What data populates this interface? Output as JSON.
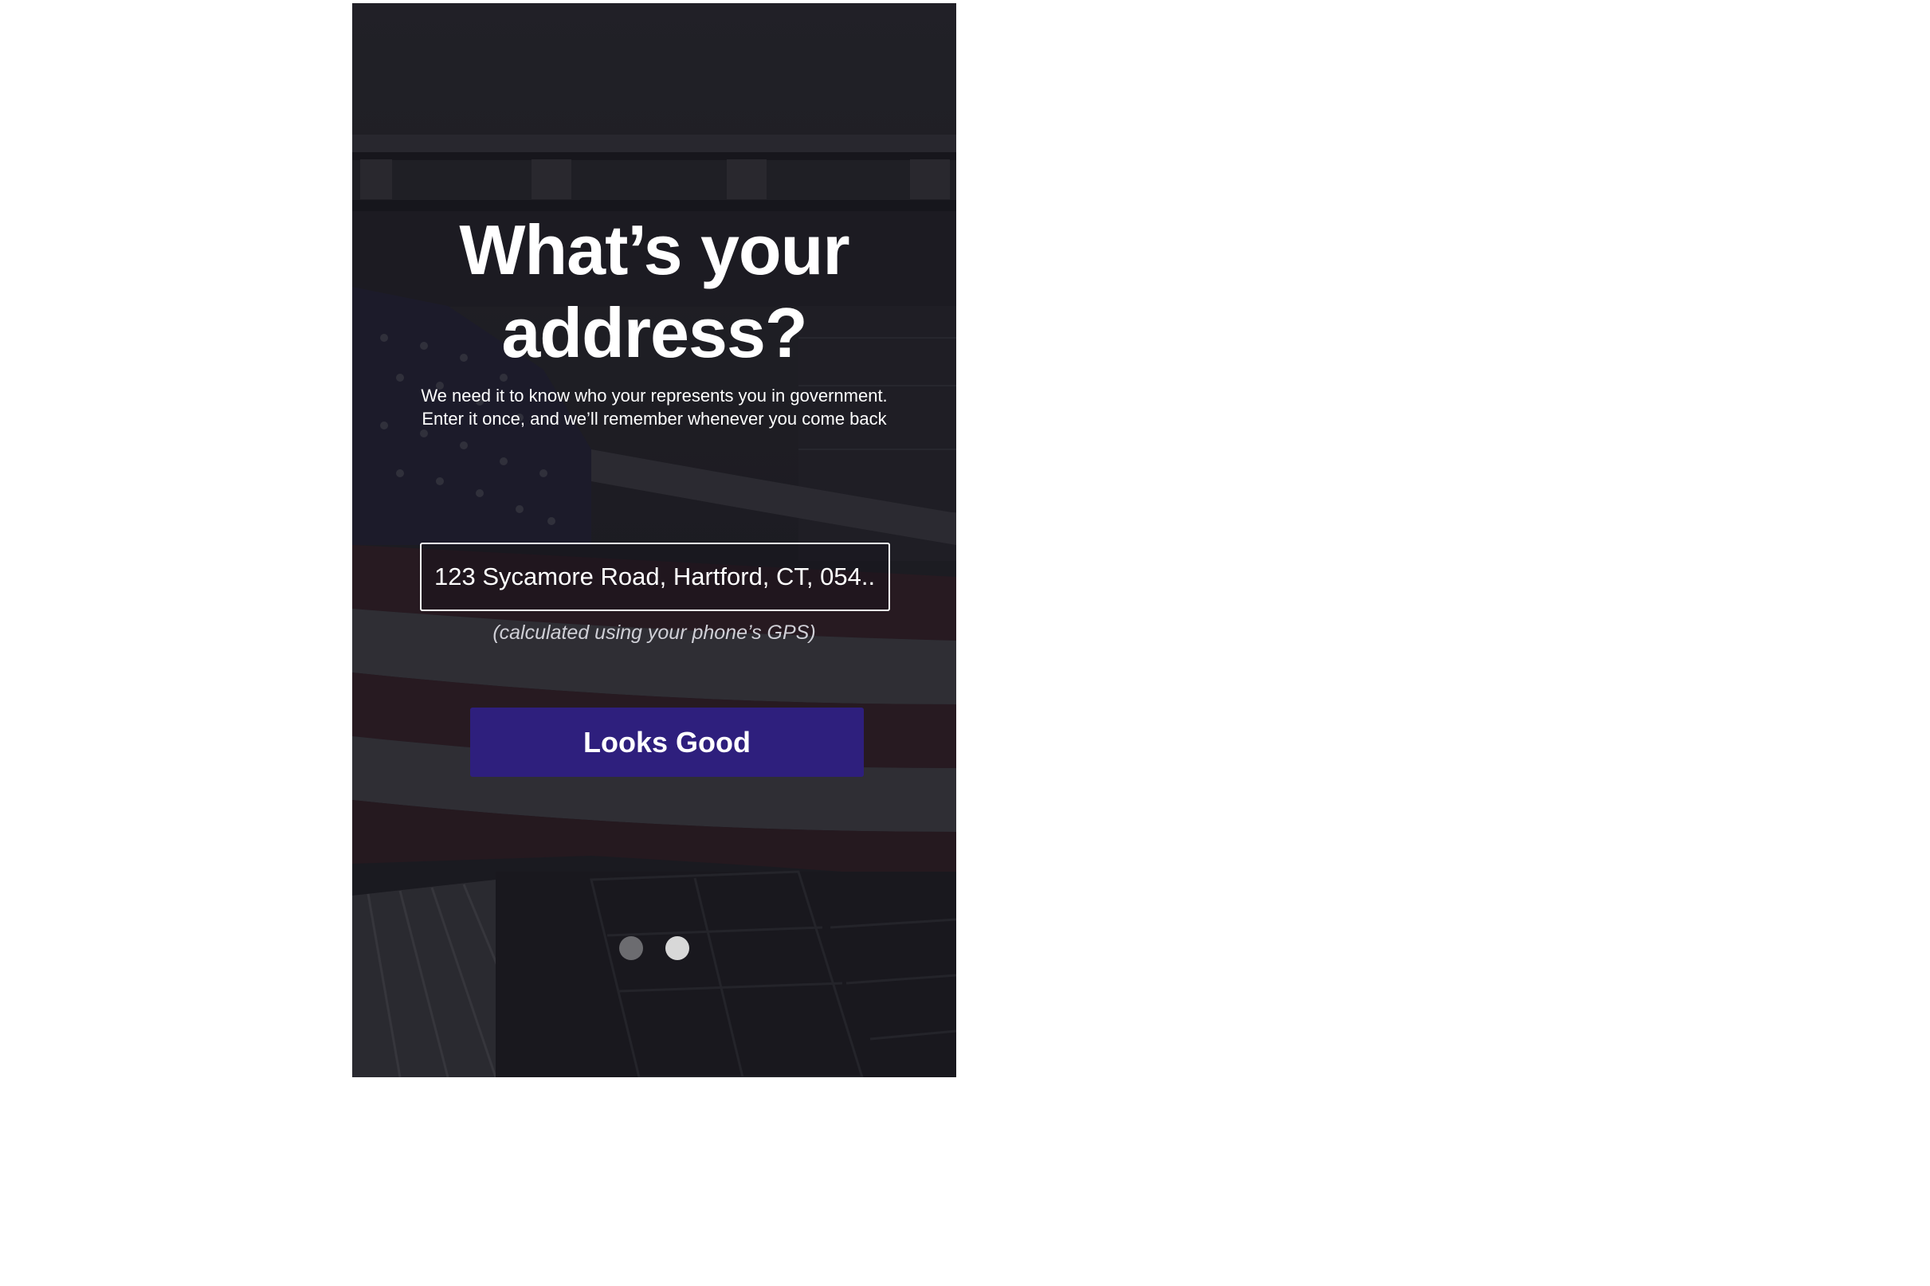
{
  "onboarding": {
    "title_line1": "What’s your",
    "title_line2": "address?",
    "subtitle_line1": "We need it to know who your represents you in government.",
    "subtitle_line2": "Enter it once, and we’ll remember whenever you come back",
    "address_value": "123 Sycamore Road, Hartford, CT, 054..",
    "gps_note": "(calculated using your phone’s GPS)",
    "submit_label": "Looks Good"
  },
  "pager": {
    "pages": 2,
    "current_page": 2
  },
  "colors": {
    "button": "#2e1f7d",
    "dot_active": "#d8d8d8",
    "dot_inactive": "#6c6c70",
    "text": "#ffffff"
  },
  "background": "capitol-building-with-american-flag"
}
